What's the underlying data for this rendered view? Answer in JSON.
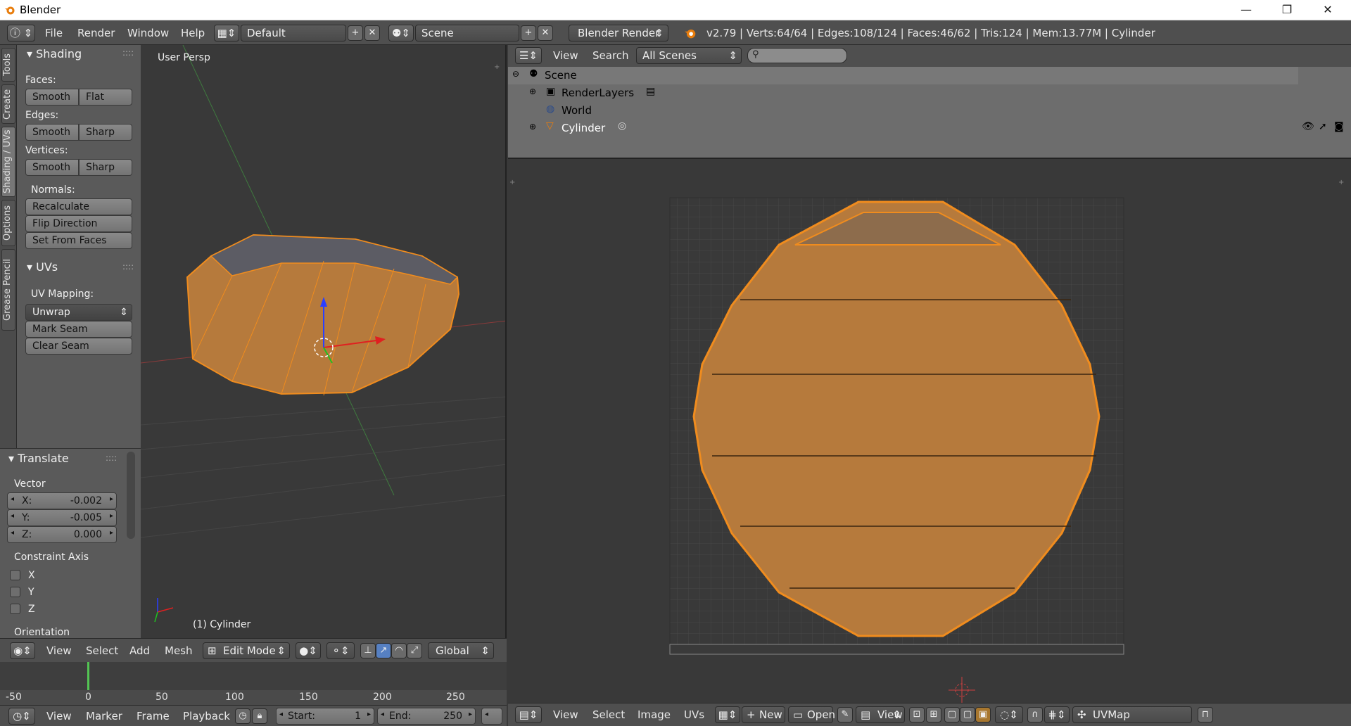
{
  "window": {
    "title": "Blender",
    "minimize": "—",
    "maximize": "❐",
    "close": "✕"
  },
  "info": {
    "menus": [
      "File",
      "Render",
      "Window",
      "Help"
    ],
    "layout": "Default",
    "scene": "Scene",
    "engine": "Blender Render",
    "stats": "v2.79 | Verts:64/64 | Edges:108/124 | Faces:46/62 | Tris:124 | Mem:13.77M | Cylinder"
  },
  "tabs": [
    "Tools",
    "Create",
    "Shading / UVs",
    "Options",
    "Grease Pencil"
  ],
  "shading": {
    "title": "Shading",
    "faces": "Faces:",
    "edges": "Edges:",
    "vertices": "Vertices:",
    "normals": "Normals:",
    "smooth": "Smooth",
    "flat": "Flat",
    "sharp": "Sharp",
    "recalculate": "Recalculate",
    "flip": "Flip Direction",
    "set_from_faces": "Set From Faces"
  },
  "uvs": {
    "title": "UVs",
    "mapping": "UV Mapping:",
    "unwrap": "Unwrap",
    "mark_seam": "Mark Seam",
    "clear_seam": "Clear Seam"
  },
  "translate": {
    "title": "Translate",
    "vector": "Vector",
    "x_label": "X:",
    "x": "-0.002",
    "y_label": "Y:",
    "y": "-0.005",
    "z_label": "Z:",
    "z": "0.000",
    "constraint": "Constraint Axis",
    "ax_x": "X",
    "ax_y": "Y",
    "ax_z": "Z",
    "orientation": "Orientation"
  },
  "view3d": {
    "persp": "User Persp",
    "object": "(1) Cylinder",
    "menus": [
      "View",
      "Select",
      "Add",
      "Mesh"
    ],
    "mode": "Edit Mode",
    "orient": "Global"
  },
  "timeline": {
    "ticks": [
      "-50",
      "0",
      "50",
      "100",
      "150",
      "200",
      "250"
    ],
    "menus": [
      "View",
      "Marker",
      "Frame",
      "Playback"
    ],
    "start_label": "Start:",
    "start": "1",
    "end_label": "End:",
    "end": "250"
  },
  "outliner": {
    "menus": [
      "View",
      "Search"
    ],
    "filter": "All Scenes",
    "rows": [
      "Scene",
      "RenderLayers",
      "World",
      "Cylinder"
    ]
  },
  "uv": {
    "menus": [
      "View",
      "Select",
      "Image",
      "UVs"
    ],
    "new": "New",
    "open": "Open",
    "view": "View",
    "map": "UVMap"
  },
  "colors": {
    "orange": "#f08c1e",
    "mesh_fill": "#b67a3c",
    "panel": "#5a5a5a",
    "header": "#4f4f4f"
  }
}
